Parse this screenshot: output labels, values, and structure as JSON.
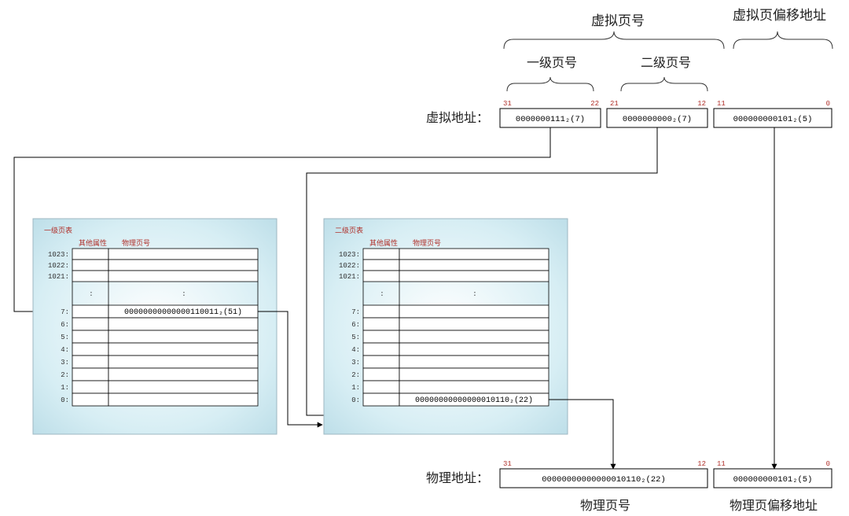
{
  "labels": {
    "vpn": "虚拟页号",
    "vpo": "虚拟页偏移地址",
    "l1_page_no": "一级页号",
    "l2_page_no": "二级页号",
    "vaddr": "虚拟地址：",
    "paddr": "物理地址：",
    "ppn": "物理页号",
    "ppo": "物理页偏移地址",
    "l1_table": "一级页表",
    "l2_table": "二级页表",
    "other_attr": "其他属性",
    "phys_page_no": "物理页号"
  },
  "bit_labels": {
    "va_hi": "31",
    "va_m1": "22",
    "va_m2": "21",
    "va_m3": "12",
    "va_m4": "11",
    "va_lo": "0",
    "pa_hi": "31",
    "pa_m1": "12",
    "pa_m2": "11",
    "pa_lo": "0"
  },
  "vaddr_fields": {
    "l1": "0000000111₂(7)",
    "l2": "0000000000₂(7)",
    "off": "000000000101₂(5)"
  },
  "paddr_fields": {
    "ppn": "00000000000000010110₂(22)",
    "off": "000000000101₂(5)"
  },
  "page_table": {
    "row_idx_top": [
      "1023:",
      "1022:",
      "1021:"
    ],
    "row_idx_bottom": [
      "7:",
      "6:",
      "5:",
      "4:",
      "3:",
      "2:",
      "1:",
      "0:"
    ],
    "ellipsis_l": ":",
    "ellipsis_r": ":",
    "l1_entry_row": "7",
    "l1_entry_val": "00000000000000110011₂(51)",
    "l2_entry_row": "0",
    "l2_entry_val": "00000000000000010110₂(22)"
  }
}
